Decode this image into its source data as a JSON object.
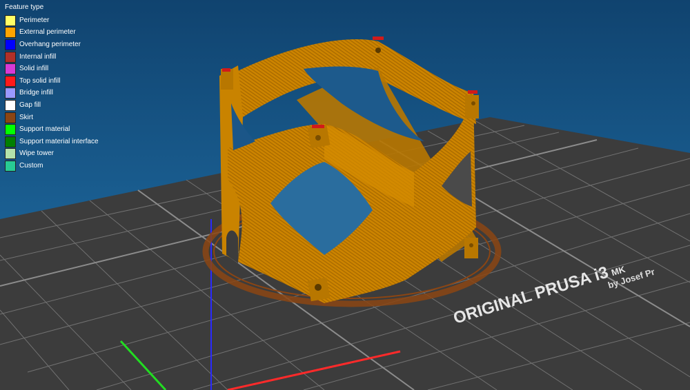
{
  "legend": {
    "title": "Feature type",
    "items": [
      {
        "label": "Perimeter",
        "color": "#ffff66"
      },
      {
        "label": "External perimeter",
        "color": "#ffa500"
      },
      {
        "label": "Overhang perimeter",
        "color": "#0000ff"
      },
      {
        "label": "Internal infill",
        "color": "#b03029"
      },
      {
        "label": "Solid infill",
        "color": "#d63ad6"
      },
      {
        "label": "Top solid infill",
        "color": "#ff1a1a"
      },
      {
        "label": "Bridge infill",
        "color": "#9999ff"
      },
      {
        "label": "Gap fill",
        "color": "#ffffff"
      },
      {
        "label": "Skirt",
        "color": "#8b4513"
      },
      {
        "label": "Support material",
        "color": "#00ff00"
      },
      {
        "label": "Support material interface",
        "color": "#008000"
      },
      {
        "label": "Wipe tower",
        "color": "#b3e3ab"
      },
      {
        "label": "Custom",
        "color": "#28cc94"
      }
    ]
  },
  "bed": {
    "brand": "ORIGINAL PRUSA i3",
    "model": "MK",
    "maker": "by Josef Pr"
  },
  "colors": {
    "background_top": "#10436f",
    "background_bottom": "#2474ad",
    "bed": "#3d3d3d",
    "grid": "#6f6f6f",
    "model": "#cc8400",
    "axis_x": "#ff2a2a",
    "axis_y": "#22dd22",
    "axis_z": "#2a2aff"
  }
}
